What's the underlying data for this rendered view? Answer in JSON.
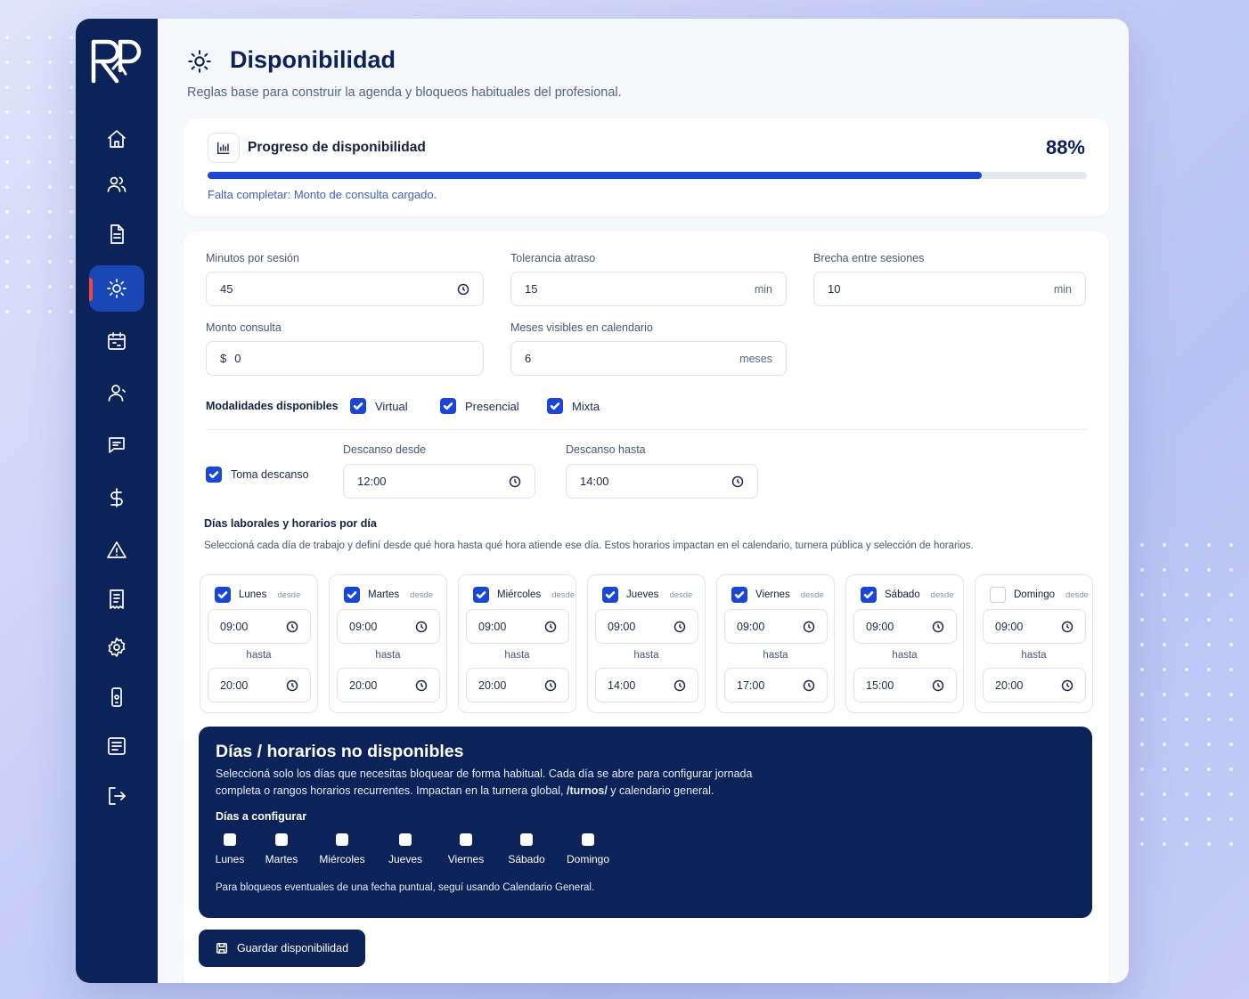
{
  "colors": {
    "navy": "#0b2358",
    "accent": "#1946d6",
    "active_indicator": "#ef4444"
  },
  "sidebar": {
    "items": [
      {
        "icon": "home-icon"
      },
      {
        "icon": "users-icon"
      },
      {
        "icon": "document-icon"
      },
      {
        "icon": "sun-icon",
        "active": true
      },
      {
        "icon": "calendar-icon"
      },
      {
        "icon": "user-icon"
      },
      {
        "icon": "message-icon"
      },
      {
        "icon": "dollar-icon"
      },
      {
        "icon": "warning-icon"
      },
      {
        "icon": "receipt-icon"
      },
      {
        "icon": "settings-icon"
      },
      {
        "icon": "phone-icon"
      },
      {
        "icon": "list-icon"
      },
      {
        "icon": "logout-icon"
      }
    ]
  },
  "header": {
    "title": "Disponibilidad",
    "subtitle": "Reglas base para construir la agenda y bloqueos habituales del profesional."
  },
  "progress": {
    "title": "Progreso de disponibilidad",
    "percent_label": "88%",
    "value": 0.88,
    "note": "Falta completar: Monto de consulta cargado."
  },
  "form": {
    "minutos": {
      "label": "Minutos por sesión",
      "value": "45"
    },
    "tolerancia": {
      "label": "Tolerancia atraso",
      "value": "15",
      "unit": "min"
    },
    "brecha": {
      "label": "Brecha entre sesiones",
      "value": "10",
      "unit": "min"
    },
    "monto": {
      "label": "Monto consulta",
      "prefix": "$",
      "value": "0"
    },
    "meses": {
      "label": "Meses visibles en calendario",
      "value": "6",
      "unit": "meses"
    },
    "modalidades": {
      "label": "Modalidades disponibles",
      "options": [
        {
          "label": "Virtual",
          "checked": true
        },
        {
          "label": "Presencial",
          "checked": true
        },
        {
          "label": "Mixta",
          "checked": true
        }
      ]
    },
    "descanso": {
      "toggle_label": "Toma descanso",
      "checked": true,
      "desde_label": "Descanso desde",
      "desde": "12:00",
      "hasta_label": "Descanso hasta",
      "hasta": "14:00"
    }
  },
  "days": {
    "title": "Días laborales y horarios por día",
    "description": "Seleccioná cada día de trabajo y definí desde qué hora hasta qué hora atiende ese día. Estos horarios impactan en el calendario, turnera pública y selección de horarios.",
    "desde_label": "desde",
    "hasta_label": "hasta",
    "items": [
      {
        "name": "Lunes",
        "checked": true,
        "from": "09:00",
        "to": "20:00"
      },
      {
        "name": "Martes",
        "checked": true,
        "from": "09:00",
        "to": "20:00"
      },
      {
        "name": "Miércoles",
        "checked": true,
        "from": "09:00",
        "to": "20:00"
      },
      {
        "name": "Jueves",
        "checked": true,
        "from": "09:00",
        "to": "14:00"
      },
      {
        "name": "Viernes",
        "checked": true,
        "from": "09:00",
        "to": "17:00"
      },
      {
        "name": "Sábado",
        "checked": true,
        "from": "09:00",
        "to": "15:00"
      },
      {
        "name": "Domingo",
        "checked": false,
        "from": "09:00",
        "to": "20:00"
      }
    ]
  },
  "blocked": {
    "title": "Días / horarios no disponibles",
    "desc_1": "Seleccioná solo los días que necesitas bloquear de forma habitual. Cada día se abre para configurar jornada completa o rangos horarios recurrentes. Impactan en la turnera global, ",
    "desc_bold": "/turnos/",
    "desc_2": " y calendario general.",
    "subtitle": "Días a configurar",
    "days": [
      "Lunes",
      "Martes",
      "Miércoles",
      "Jueves",
      "Viernes",
      "Sábado",
      "Domingo"
    ],
    "note": "Para bloqueos eventuales de una fecha puntual, seguí usando Calendario General."
  },
  "save_button": {
    "label": "Guardar disponibilidad",
    "icon": "save-icon"
  }
}
